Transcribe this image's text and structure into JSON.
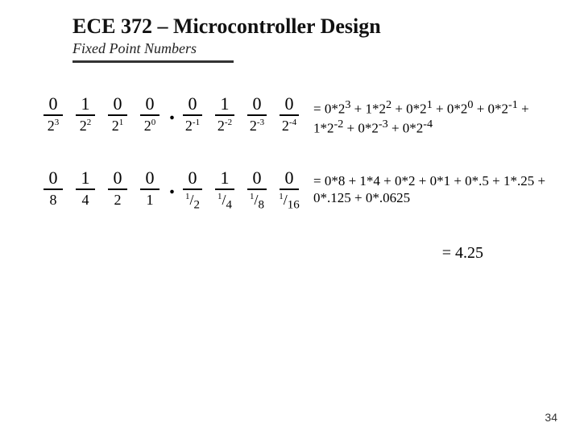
{
  "header": {
    "title": "ECE 372 – Microcontroller Design",
    "subtitle": "Fixed Point Numbers"
  },
  "rows": [
    {
      "bits": [
        "0",
        "1",
        "0",
        "0",
        "0",
        "1",
        "0",
        "0"
      ],
      "weights_html": [
        "2<sup>3</sup>",
        "2<sup>2</sup>",
        "2<sup>1</sup>",
        "2<sup>0</sup>",
        "2<sup>-1</sup>",
        "2<sup>-2</sup>",
        "2<sup>-3</sup>",
        "2<sup>-4</sup>"
      ],
      "radix_after": 4,
      "explain_html": "= 0*2<sup>3</sup> + 1*2<sup>2</sup> + 0*2<sup>1</sup> + 0*2<sup>0</sup> + 0*2<sup>-1</sup> + 1*2<sup>-2</sup> + 0*2<sup>-3</sup> + 0*2<sup>-4</sup>"
    },
    {
      "bits": [
        "0",
        "1",
        "0",
        "0",
        "0",
        "1",
        "0",
        "0"
      ],
      "weights_html": [
        "8",
        "4",
        "2",
        "1",
        "<sup>1</sup>/<sub>2</sub>",
        "<sup>1</sup>/<sub>4</sub>",
        "<sup>1</sup>/<sub>8</sub>",
        "<sup>1</sup>/<sub>16</sub>"
      ],
      "radix_after": 4,
      "explain_html": "= 0*8 + 1*4 + 0*2 + 0*1 + 0*.5 + 1*.25 + 0*.125 + 0*.0625"
    }
  ],
  "result": "= 4.25",
  "page_number": "34"
}
